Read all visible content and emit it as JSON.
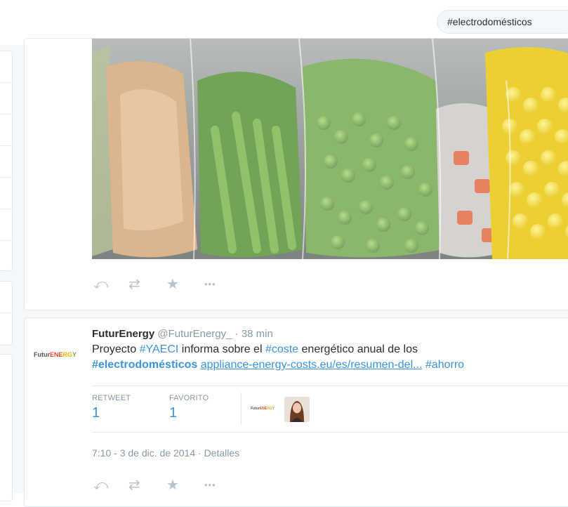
{
  "search": {
    "value": "#electrodomésticos"
  },
  "tweet1": {
    "actions": [
      "reply-icon",
      "retweet-icon",
      "favorite-icon",
      "more-icon"
    ]
  },
  "tweet2": {
    "logo": {
      "part1": "Futur",
      "part2": "ENE",
      "part3": "RG",
      "part4": "Y"
    },
    "name": "FuturEnergy",
    "handle": "@FuturEnergy_",
    "sep": " · ",
    "time": "38 min",
    "text_pre": "Proyecto ",
    "hashtag1": "#YAECI",
    "text_mid1": " informa sobre el ",
    "hashtag2": "#coste",
    "text_mid2": " energético anual de los",
    "hashtag3": "#electrodomésticos",
    "link": "appliance-energy-costs.eu/es/resumen-del...",
    "hashtag4": "#ahorro",
    "stats": {
      "retweets_label": "RETWEET",
      "retweets_value": "1",
      "favorites_label": "FAVORITO",
      "favorites_value": "1"
    },
    "mini_logo": "FuturENERGY",
    "timestamp": "7:10 - 3 de dic. de 2014",
    "details_sep": " · ",
    "details": "Detalles",
    "actions": [
      "reply-icon",
      "retweet-icon",
      "favorite-icon",
      "more-icon"
    ]
  },
  "colors": {
    "link": "#3b94d9",
    "muted": "#8899a6",
    "icon": "#b8c3cb"
  }
}
